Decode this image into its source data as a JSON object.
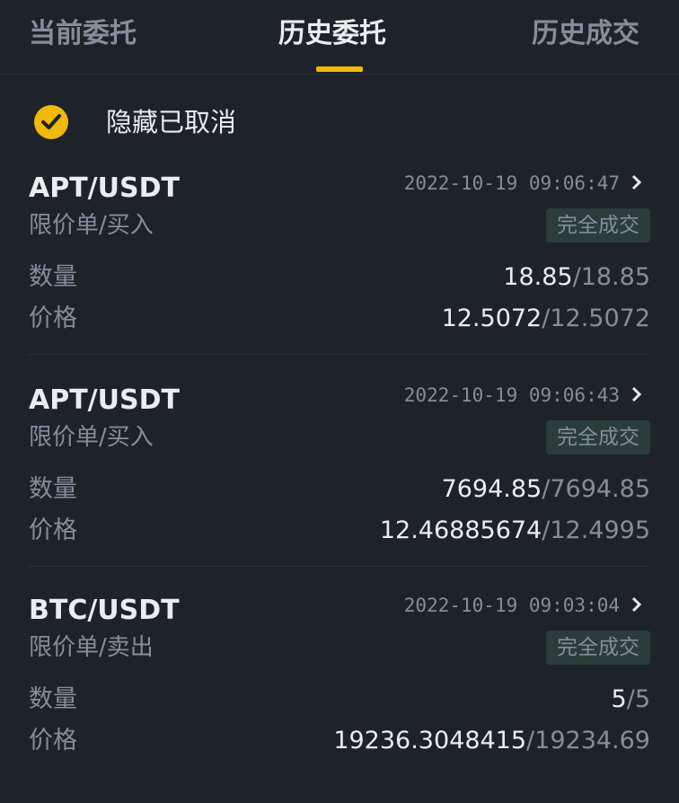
{
  "tabs": [
    {
      "label": "当前委托",
      "active": false
    },
    {
      "label": "历史委托",
      "active": true
    },
    {
      "label": "历史成交",
      "active": false
    }
  ],
  "filter": {
    "label": "隐藏已取消",
    "checked": true,
    "icon": "check-circle-icon"
  },
  "labels": {
    "quantity": "数量",
    "price": "价格"
  },
  "orders": [
    {
      "pair": "APT/USDT",
      "time": "2022-10-19 09:06:47",
      "type": "限价单/买入",
      "status": "完全成交",
      "qty_filled": "18.85",
      "qty_total": "18.85",
      "price_avg": "12.5072",
      "price_order": "12.5072"
    },
    {
      "pair": "APT/USDT",
      "time": "2022-10-19 09:06:43",
      "type": "限价单/买入",
      "status": "完全成交",
      "qty_filled": "7694.85",
      "qty_total": "7694.85",
      "price_avg": "12.46885674",
      "price_order": "12.4995"
    },
    {
      "pair": "BTC/USDT",
      "time": "2022-10-19 09:03:04",
      "type": "限价单/卖出",
      "status": "完全成交",
      "qty_filled": "5",
      "qty_total": "5",
      "price_avg": "19236.3048415",
      "price_order": "19234.69"
    }
  ],
  "separator": "/",
  "colors": {
    "background": "#1e2329",
    "accent": "#f0b90b",
    "text_primary": "#eaecef",
    "text_secondary": "#848e9c",
    "badge_bg": "#2a3d3a"
  }
}
